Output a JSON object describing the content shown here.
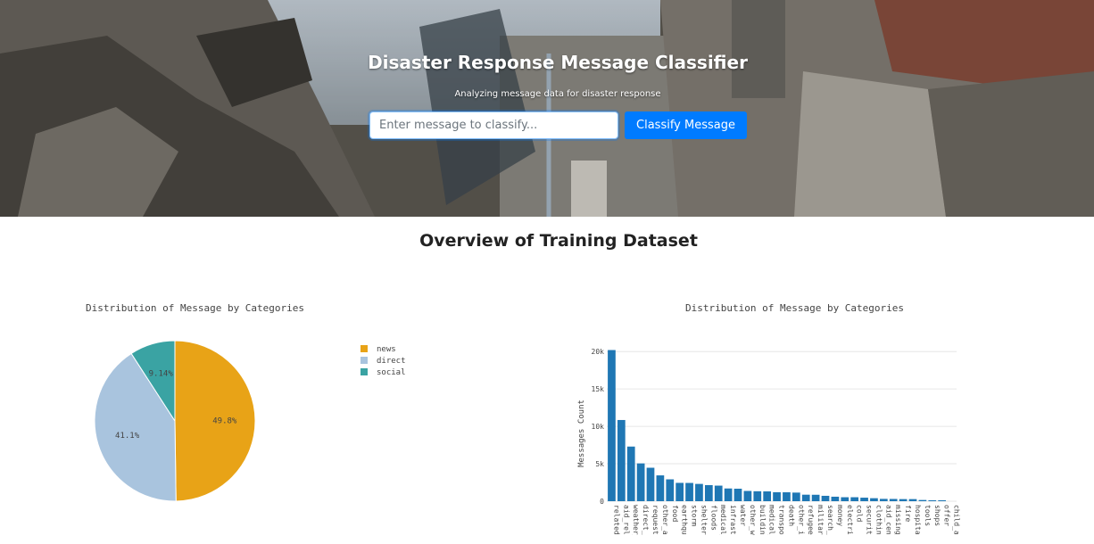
{
  "hero": {
    "title": "Disaster Response Message Classifier",
    "subtitle": "Analyzing message data for disaster response",
    "input_placeholder": "Enter message to classify...",
    "button_label": "Classify Message"
  },
  "section_title": "Overview of Training Dataset",
  "chart_data": [
    {
      "type": "pie",
      "title": "Distribution of Message by Categories",
      "labels": [
        "news",
        "direct",
        "social"
      ],
      "values": [
        49.8,
        41.1,
        9.14
      ],
      "value_labels": [
        "49.8%",
        "41.1%",
        "9.14%"
      ],
      "colors": [
        "#e8a317",
        "#a9c4de",
        "#3aa3a3"
      ],
      "legend_position": "right"
    },
    {
      "type": "bar",
      "title": "Distribution of Message by Categories",
      "ylabel": "Messages Count",
      "xlabel": "",
      "ylim": [
        0,
        20500
      ],
      "yticks": [
        0,
        5000,
        10000,
        15000,
        20000
      ],
      "ytick_labels": [
        "0",
        "5k",
        "10k",
        "15k",
        "20k"
      ],
      "color": "#1f77b4",
      "grid": true,
      "categories": [
        "related",
        "aid_related",
        "weather_related",
        "direct_report",
        "request",
        "other_aid",
        "food",
        "earthquake",
        "storm",
        "shelter",
        "floods",
        "medical_help",
        "infrastructure_related",
        "water",
        "other_weather",
        "buildings",
        "medical_products",
        "transport",
        "death",
        "other_infrastructure",
        "refugees",
        "military",
        "search_and_rescue",
        "money",
        "electricity",
        "cold",
        "security",
        "clothing",
        "aid_centers",
        "missing_people",
        "hospitals",
        "fire",
        "tools",
        "shops",
        "offer",
        "child_alone"
      ],
      "tick_labels": [
        "related",
        "aid_relate",
        "weather_r",
        "direct_rep",
        "request",
        "other_aid",
        "food",
        "earthquak",
        "storm",
        "shelter",
        "floods",
        "medical_h",
        "infrastruct",
        "water",
        "other_wea",
        "buildings",
        "medical_p",
        "transport",
        "death",
        "other_infra",
        "refugees",
        "military",
        "search_an",
        "money",
        "electricity",
        "cold",
        "security",
        "clothing",
        "aid_center",
        "missing_p",
        "fire",
        "hospitals",
        "tools",
        "shops",
        "offer",
        "child_alon"
      ],
      "values": [
        20200,
        10850,
        7300,
        5050,
        4470,
        3450,
        2920,
        2450,
        2440,
        2310,
        2150,
        2080,
        1700,
        1670,
        1370,
        1330,
        1310,
        1200,
        1190,
        1150,
        870,
        860,
        720,
        600,
        530,
        530,
        470,
        400,
        310,
        300,
        280,
        280,
        160,
        120,
        120,
        0
      ]
    }
  ]
}
